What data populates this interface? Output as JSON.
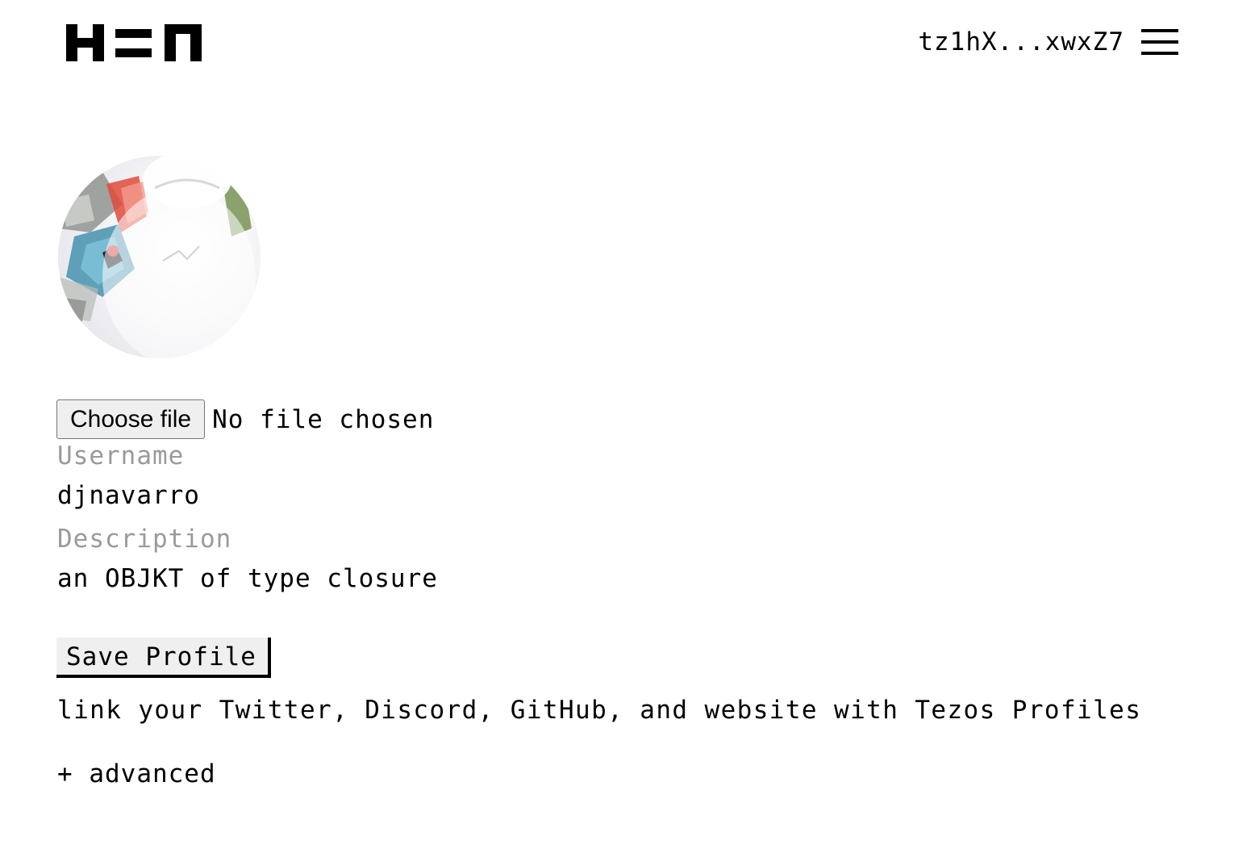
{
  "header": {
    "logo_icon": "hen-logo-icon",
    "wallet_address": "tz1hX...xwxZ7",
    "menu_icon": "hamburger-menu-icon"
  },
  "profile": {
    "avatar_icon": "avatar-image",
    "file_input": {
      "button_label": "Choose file",
      "status": "No file chosen"
    },
    "username": {
      "label": "Username",
      "value": "djnavarro"
    },
    "description": {
      "label": "Description",
      "value": "an OBJKT of type closure"
    },
    "save_label": "Save Profile",
    "tezos_profiles_link": "link your Twitter, Discord, GitHub, and website with Tezos Profiles",
    "advanced_toggle": "+ advanced"
  },
  "colors": {
    "text": "#000000",
    "label_gray": "#9a9a9a",
    "button_bg": "#efefef",
    "background": "#ffffff"
  }
}
